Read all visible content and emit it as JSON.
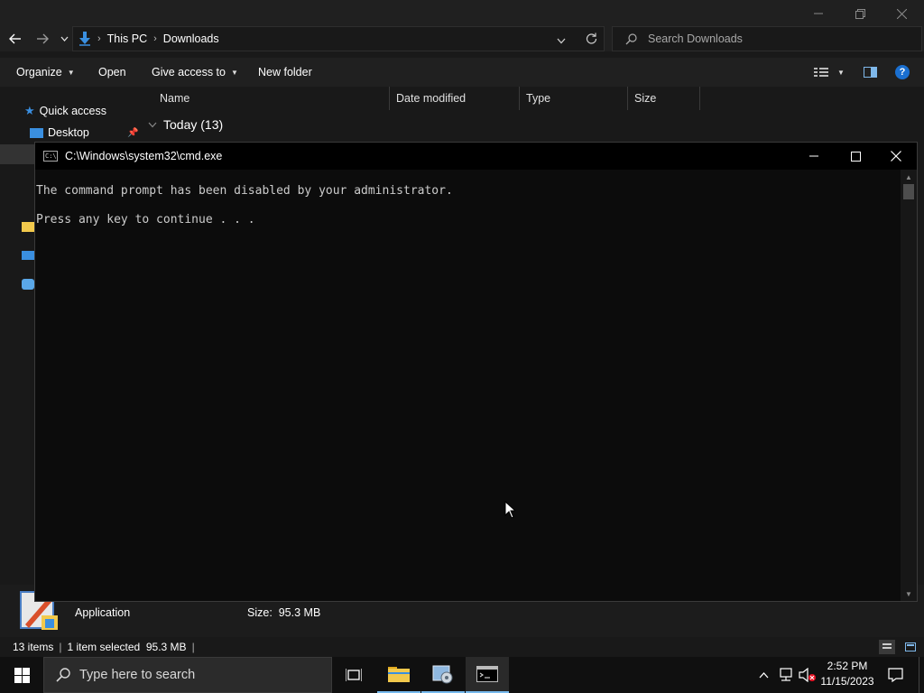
{
  "explorer": {
    "breadcrumb": [
      "This PC",
      "Downloads"
    ],
    "search_placeholder": "Search Downloads",
    "commands": {
      "organize": "Organize",
      "open": "Open",
      "give_access": "Give access to",
      "new_folder": "New folder"
    },
    "nav": {
      "quick_access": "Quick access",
      "desktop": "Desktop"
    },
    "columns": {
      "name": "Name",
      "date_modified": "Date modified",
      "type": "Type",
      "size": "Size"
    },
    "group_header": "Today (13)",
    "details": {
      "type": "Application",
      "size": "Size:  95.3 MB"
    },
    "status": {
      "items": "13 items",
      "selected": "1 item selected  95.3 MB"
    }
  },
  "cmd": {
    "title": "C:\\Windows\\system32\\cmd.exe",
    "lines": [
      "The command prompt has been disabled by your administrator.",
      "Press any key to continue . . ."
    ]
  },
  "taskbar": {
    "search_placeholder": "Type here to search",
    "time": "2:52 PM",
    "date": "11/15/2023"
  },
  "colors": {
    "accent": "#76b9ed",
    "console_bg": "#0c0c0c",
    "console_text": "#cccccc",
    "explorer_bg": "#191919",
    "folder_yellow": "#f2c94c",
    "downloads_blue": "#3a8fe0"
  }
}
